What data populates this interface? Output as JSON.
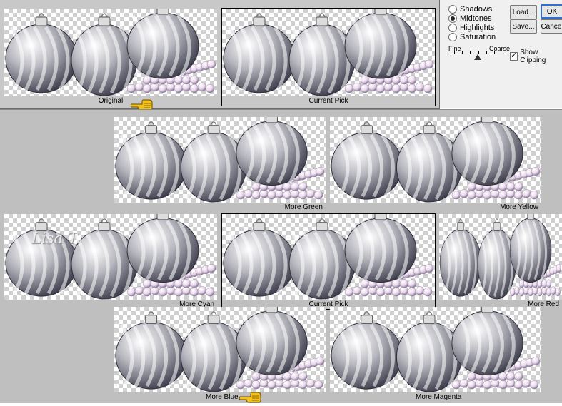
{
  "top": {
    "original_label": "Original",
    "current_pick_label": "Current Pick"
  },
  "controls": {
    "tones": [
      {
        "label": "Shadows",
        "selected": false
      },
      {
        "label": "Midtones",
        "selected": true
      },
      {
        "label": "Highlights",
        "selected": false
      },
      {
        "label": "Saturation",
        "selected": false
      }
    ],
    "fine_label": "Fine",
    "coarse_label": "Coarse",
    "fine_coarse_level": 0.5,
    "show_clipping_label": "Show Clipping",
    "show_clipping_checked": true,
    "load_label": "Load...",
    "save_label": "Save...",
    "ok_label": "OK",
    "cancel_label": "Cancel"
  },
  "variations": {
    "more_green": "More Green",
    "more_yellow": "More Yellow",
    "more_cyan": "More Cyan",
    "current_pick": "Current Pick",
    "more_red": "More Red",
    "more_blue": "More Blue",
    "more_magenta": "More Magenta"
  },
  "signature": "Lisa T",
  "tints": {
    "original": "#b7b7bf",
    "current_pick": "#a9a6d6",
    "more_green": "#9cc8c4",
    "more_yellow": "#c2bfc6",
    "more_cyan": "#93b4d4",
    "more_red": "#c09ac0",
    "more_blue": "#9590dc",
    "more_magenta": "#b08bd2",
    "pearl_original": "#ead8ea",
    "pearl_current_pick": "#d9c6ea",
    "pearl_more_green": "#d6dcec",
    "pearl_more_yellow": "#eacfe4",
    "pearl_more_cyan": "#ccd4ee",
    "pearl_more_red": "#e6c4e2",
    "pearl_more_blue": "#c9bff0",
    "pearl_more_magenta": "#dcb9ec",
    "pointer_color": "#f3c21a"
  }
}
